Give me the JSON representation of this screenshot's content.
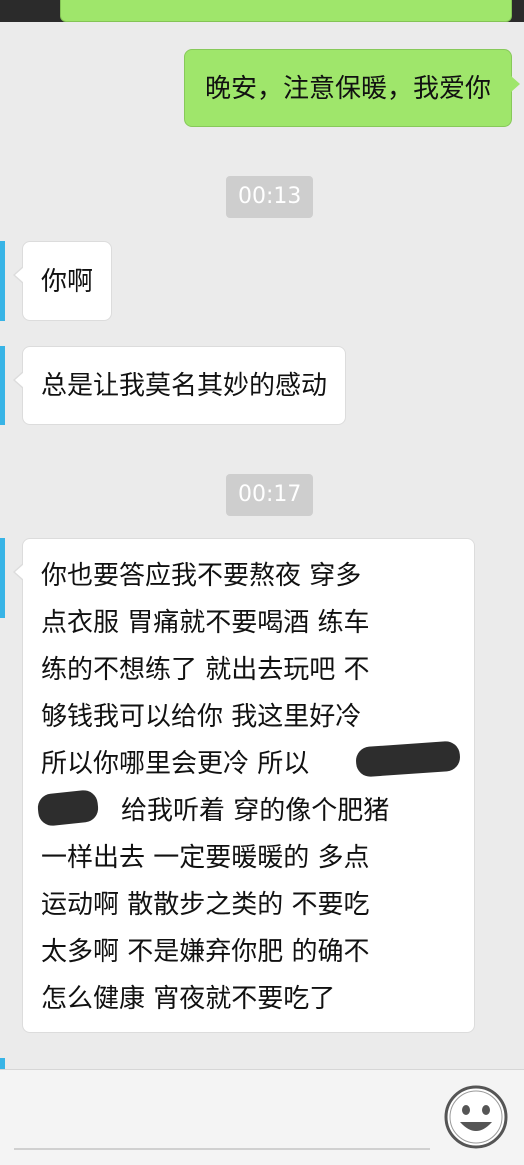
{
  "chat": {
    "sent_messages": [
      {
        "text": "晚安，注意保暖，我爱你"
      }
    ],
    "timestamps": [
      "00:13",
      "00:17"
    ],
    "received_messages": [
      {
        "text": "你啊"
      },
      {
        "text": "总是让我莫名其妙的感动"
      },
      {
        "lines": [
          "你也要答应我不要熬夜 穿多",
          "点衣服 胃痛就不要喝酒 练车",
          "练的不想练了 就出去玩吧 不",
          "够钱我可以给你 我这里好冷",
          "所以你哪里会更冷 所以",
          "给我听着 穿的像个肥猪",
          "一样出去 一定要暖暖的 多点",
          "运动啊 散散步之类的 不要吃",
          "太多啊 不是嫌弃你肥 的确不",
          "怎么健康 宵夜就不要吃了"
        ]
      }
    ]
  },
  "input_bar": {
    "emoji_icon": "smiley-face-icon"
  },
  "colors": {
    "background": "#ebebeb",
    "sent_bubble": "#9fe66b",
    "received_bubble": "#ffffff",
    "timestamp_bg": "#cecece",
    "accent_bar": "#38b4e6",
    "redaction": "#2d2d2d"
  }
}
